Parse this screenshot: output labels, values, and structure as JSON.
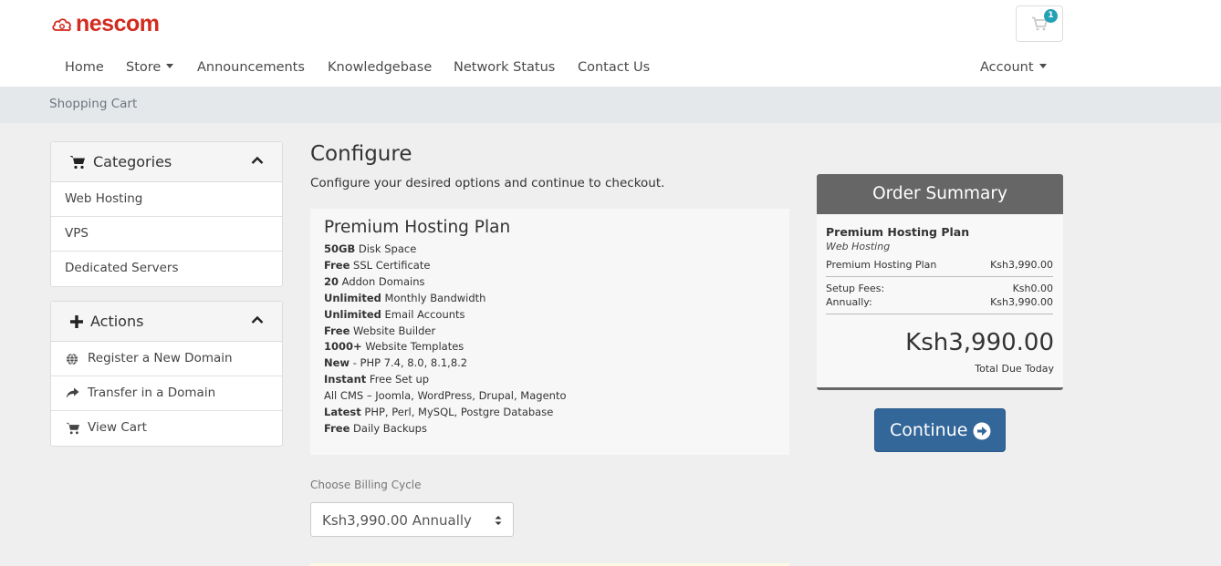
{
  "brand": {
    "name": "nescom",
    "color": "#d22b1f"
  },
  "cart": {
    "count": "1",
    "icon": "shopping-cart-icon"
  },
  "nav": {
    "home": "Home",
    "store": "Store",
    "announcements": "Announcements",
    "knowledgebase": "Knowledgebase",
    "network_status": "Network Status",
    "contact_us": "Contact Us",
    "account": "Account"
  },
  "breadcrumb": "Shopping Cart",
  "sidebar": {
    "categories": {
      "title": "Categories",
      "items": [
        "Web Hosting",
        "VPS",
        "Dedicated Servers"
      ]
    },
    "actions": {
      "title": "Actions",
      "items": [
        {
          "label": "Register a New Domain",
          "icon": "globe-icon"
        },
        {
          "label": "Transfer in a Domain",
          "icon": "share-arrow-icon"
        },
        {
          "label": "View Cart",
          "icon": "shopping-cart-icon"
        }
      ]
    }
  },
  "main": {
    "title": "Configure",
    "subtitle": "Configure your desired options and continue to checkout.",
    "plan": {
      "name": "Premium Hosting Plan",
      "features": [
        {
          "bold": "50GB",
          "text": " Disk Space"
        },
        {
          "bold": "Free",
          "text": " SSL Certificate"
        },
        {
          "bold": "20",
          "text": " Addon Domains"
        },
        {
          "bold": "Unlimited",
          "text": " Monthly Bandwidth"
        },
        {
          "bold": "Unlimited",
          "text": " Email Accounts"
        },
        {
          "bold": "Free",
          "text": " Website Builder"
        },
        {
          "bold": "1000+",
          "text": " Website Templates"
        },
        {
          "bold": "New",
          "text": " - PHP 7.4, 8.0, 8.1,8.2"
        },
        {
          "bold": "Instant",
          "text": " Free Set up"
        },
        {
          "bold": "",
          "text": "All CMS – Joomla, WordPress, Drupal, Magento"
        },
        {
          "bold": "Latest",
          "text": " PHP, Perl, MySQL, Postgre Database"
        },
        {
          "bold": "Free",
          "text": " Daily Backups"
        }
      ]
    },
    "billing": {
      "label": "Choose Billing Cycle",
      "selected": "Ksh3,990.00 Annually"
    }
  },
  "summary": {
    "title": "Order Summary",
    "product": "Premium Hosting Plan",
    "group": "Web Hosting",
    "line_label": "Premium Hosting Plan",
    "line_value": "Ksh3,990.00",
    "setup_label": "Setup Fees:",
    "setup_value": "Ksh0.00",
    "annual_label": "Annually:",
    "annual_value": "Ksh3,990.00",
    "total": "Ksh3,990.00",
    "total_label": "Total Due Today"
  },
  "continue_label": "Continue",
  "colors": {
    "accent": "#336699",
    "badge": "#24a1b5",
    "summary_header": "#666666"
  }
}
